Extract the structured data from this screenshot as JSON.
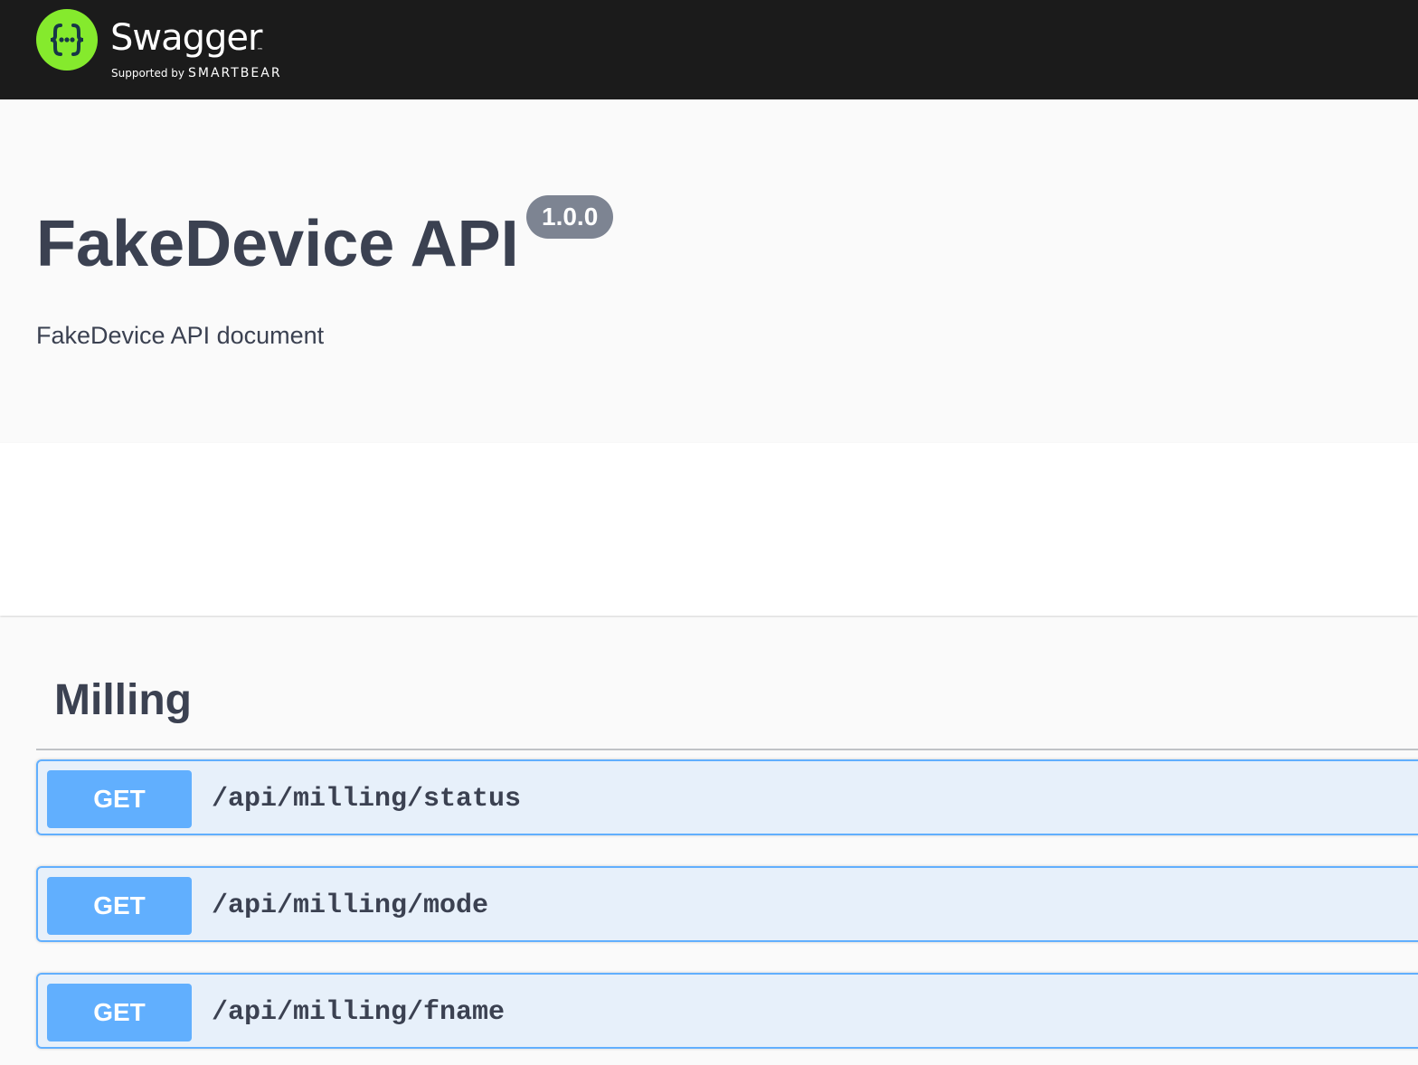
{
  "topbar": {
    "logo_icon": "swagger-braces-icon",
    "logo_text": "Swagger",
    "logo_tm": "™",
    "supported_by": "Supported by",
    "brand": "SMARTBEAR"
  },
  "info": {
    "title": "FakeDevice API",
    "version": "1.0.0",
    "description": "FakeDevice API document"
  },
  "tag": {
    "name": "Milling",
    "operations": [
      {
        "method": "GET",
        "path": "/api/milling/status"
      },
      {
        "method": "GET",
        "path": "/api/milling/mode"
      },
      {
        "method": "GET",
        "path": "/api/milling/fname"
      }
    ]
  },
  "colors": {
    "topbar_bg": "#1b1b1b",
    "logo_green": "#85ea2d",
    "get_blue": "#61affe",
    "text": "#3b4151",
    "badge_gray": "#7d8492"
  }
}
